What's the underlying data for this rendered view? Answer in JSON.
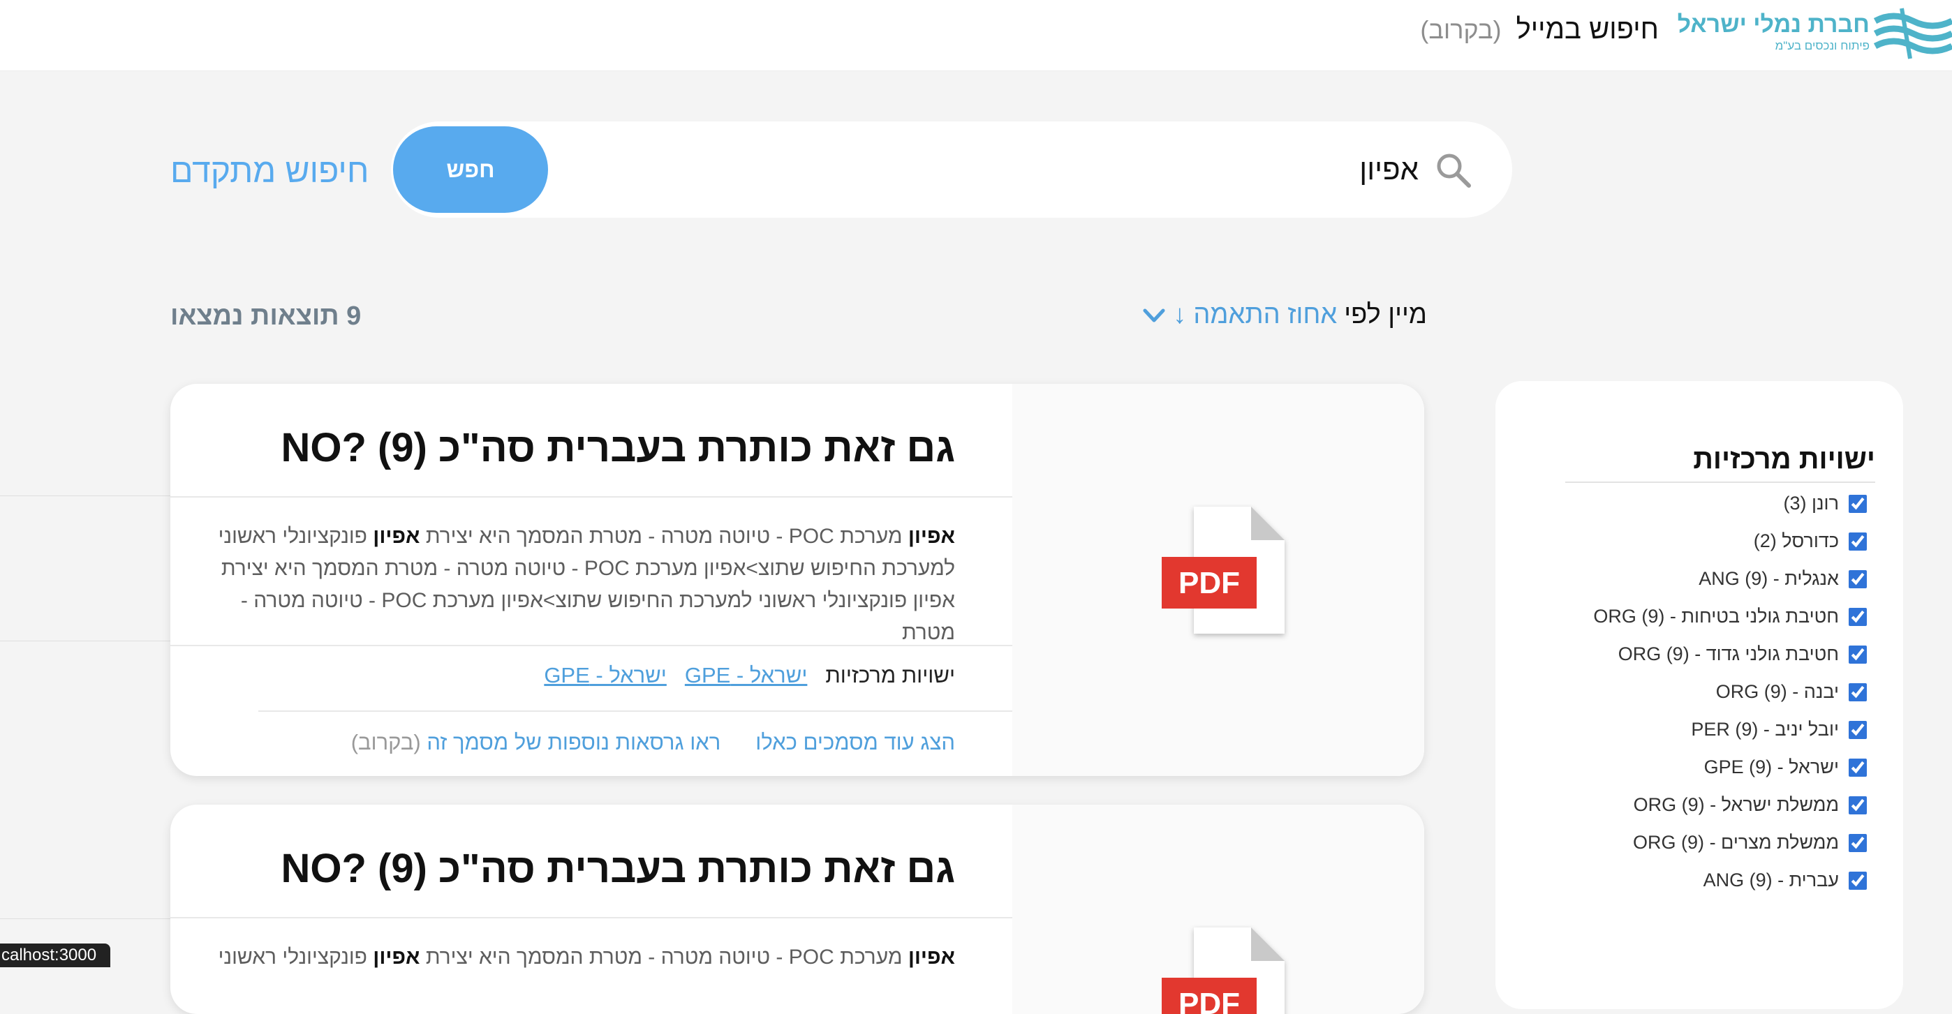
{
  "header": {
    "brand_name": "חברת נמלי ישראל",
    "brand_tagline": "פיתוח ונכסים בע\"מ",
    "page_title": "חיפוש במייל",
    "page_title_note": "(בקרוב)"
  },
  "search": {
    "query": "אפיון",
    "button_label": "חפש",
    "advanced_label": "חיפוש מתקדם"
  },
  "sort": {
    "label": "מיין לפי",
    "value": "אחוז התאמה",
    "arrow": "↓"
  },
  "results_count": "9 תוצאות נמצאו",
  "results": [
    {
      "title": "גם זאת כותרת בעברית סה\"כ (9) ?NO",
      "snippet_highlight": "אפיון",
      "snippet_a": " מערכת POC - טיוטה מטרה - מטרת המסמך היא יצירת ",
      "snippet_b": " פונקציונלי ראשוני למערכת החיפוש שתוצ>אפיון מערכת POC - טיוטה מטרה - מטרת המסמך היא יצירת אפיון פונקציונלי ראשוני למערכת החיפוש שתוצ>אפיון מערכת POC - טיוטה מטרה - מטרת",
      "entities_label": "ישויות מרכזיות",
      "entity_links": [
        "ישראל - GPE",
        "ישראל - GPE"
      ],
      "link_similar": "הצג עוד מסמכים כאלו",
      "link_versions": "ראו גרסאות נוספות של מסמך זה",
      "link_versions_note": "(בקרוב)",
      "file_type": "PDF"
    },
    {
      "title": "גם זאת כותרת בעברית סה\"כ (9) ?NO",
      "snippet_highlight": "אפיון",
      "snippet_a": " מערכת POC - טיוטה מטרה - מטרת המסמך היא יצירת ",
      "snippet_b": " פונקציונלי ראשוני",
      "file_type": "PDF"
    }
  ],
  "filters": {
    "heading": "ישויות מרכזיות",
    "items": [
      {
        "label": "רונן (3)",
        "checked": true
      },
      {
        "label": "כדורסל (2)",
        "checked": true
      },
      {
        "label": "אנגלית - ANG (9)",
        "checked": true
      },
      {
        "label": "חטיבת גולני בטיחות - ORG (9)",
        "checked": true
      },
      {
        "label": "חטיבת גולני גדוד - ORG (9)",
        "checked": true
      },
      {
        "label": "יבנה - ORG (9)",
        "checked": true
      },
      {
        "label": "יובל יניב - PER (9)",
        "checked": true
      },
      {
        "label": "ישראל - GPE (9)",
        "checked": true
      },
      {
        "label": "ממשלת ישראל - ORG (9)",
        "checked": true
      },
      {
        "label": "ממשלת מצרים - ORG (9)",
        "checked": true
      },
      {
        "label": "עברית - ANG (9)",
        "checked": true
      }
    ]
  },
  "status_tooltip": "calhost:3000",
  "colors": {
    "accent": "#58aaee",
    "link": "#4f9fdc",
    "pdf_red": "#e2382f",
    "page_bg": "#f4f4f4"
  }
}
